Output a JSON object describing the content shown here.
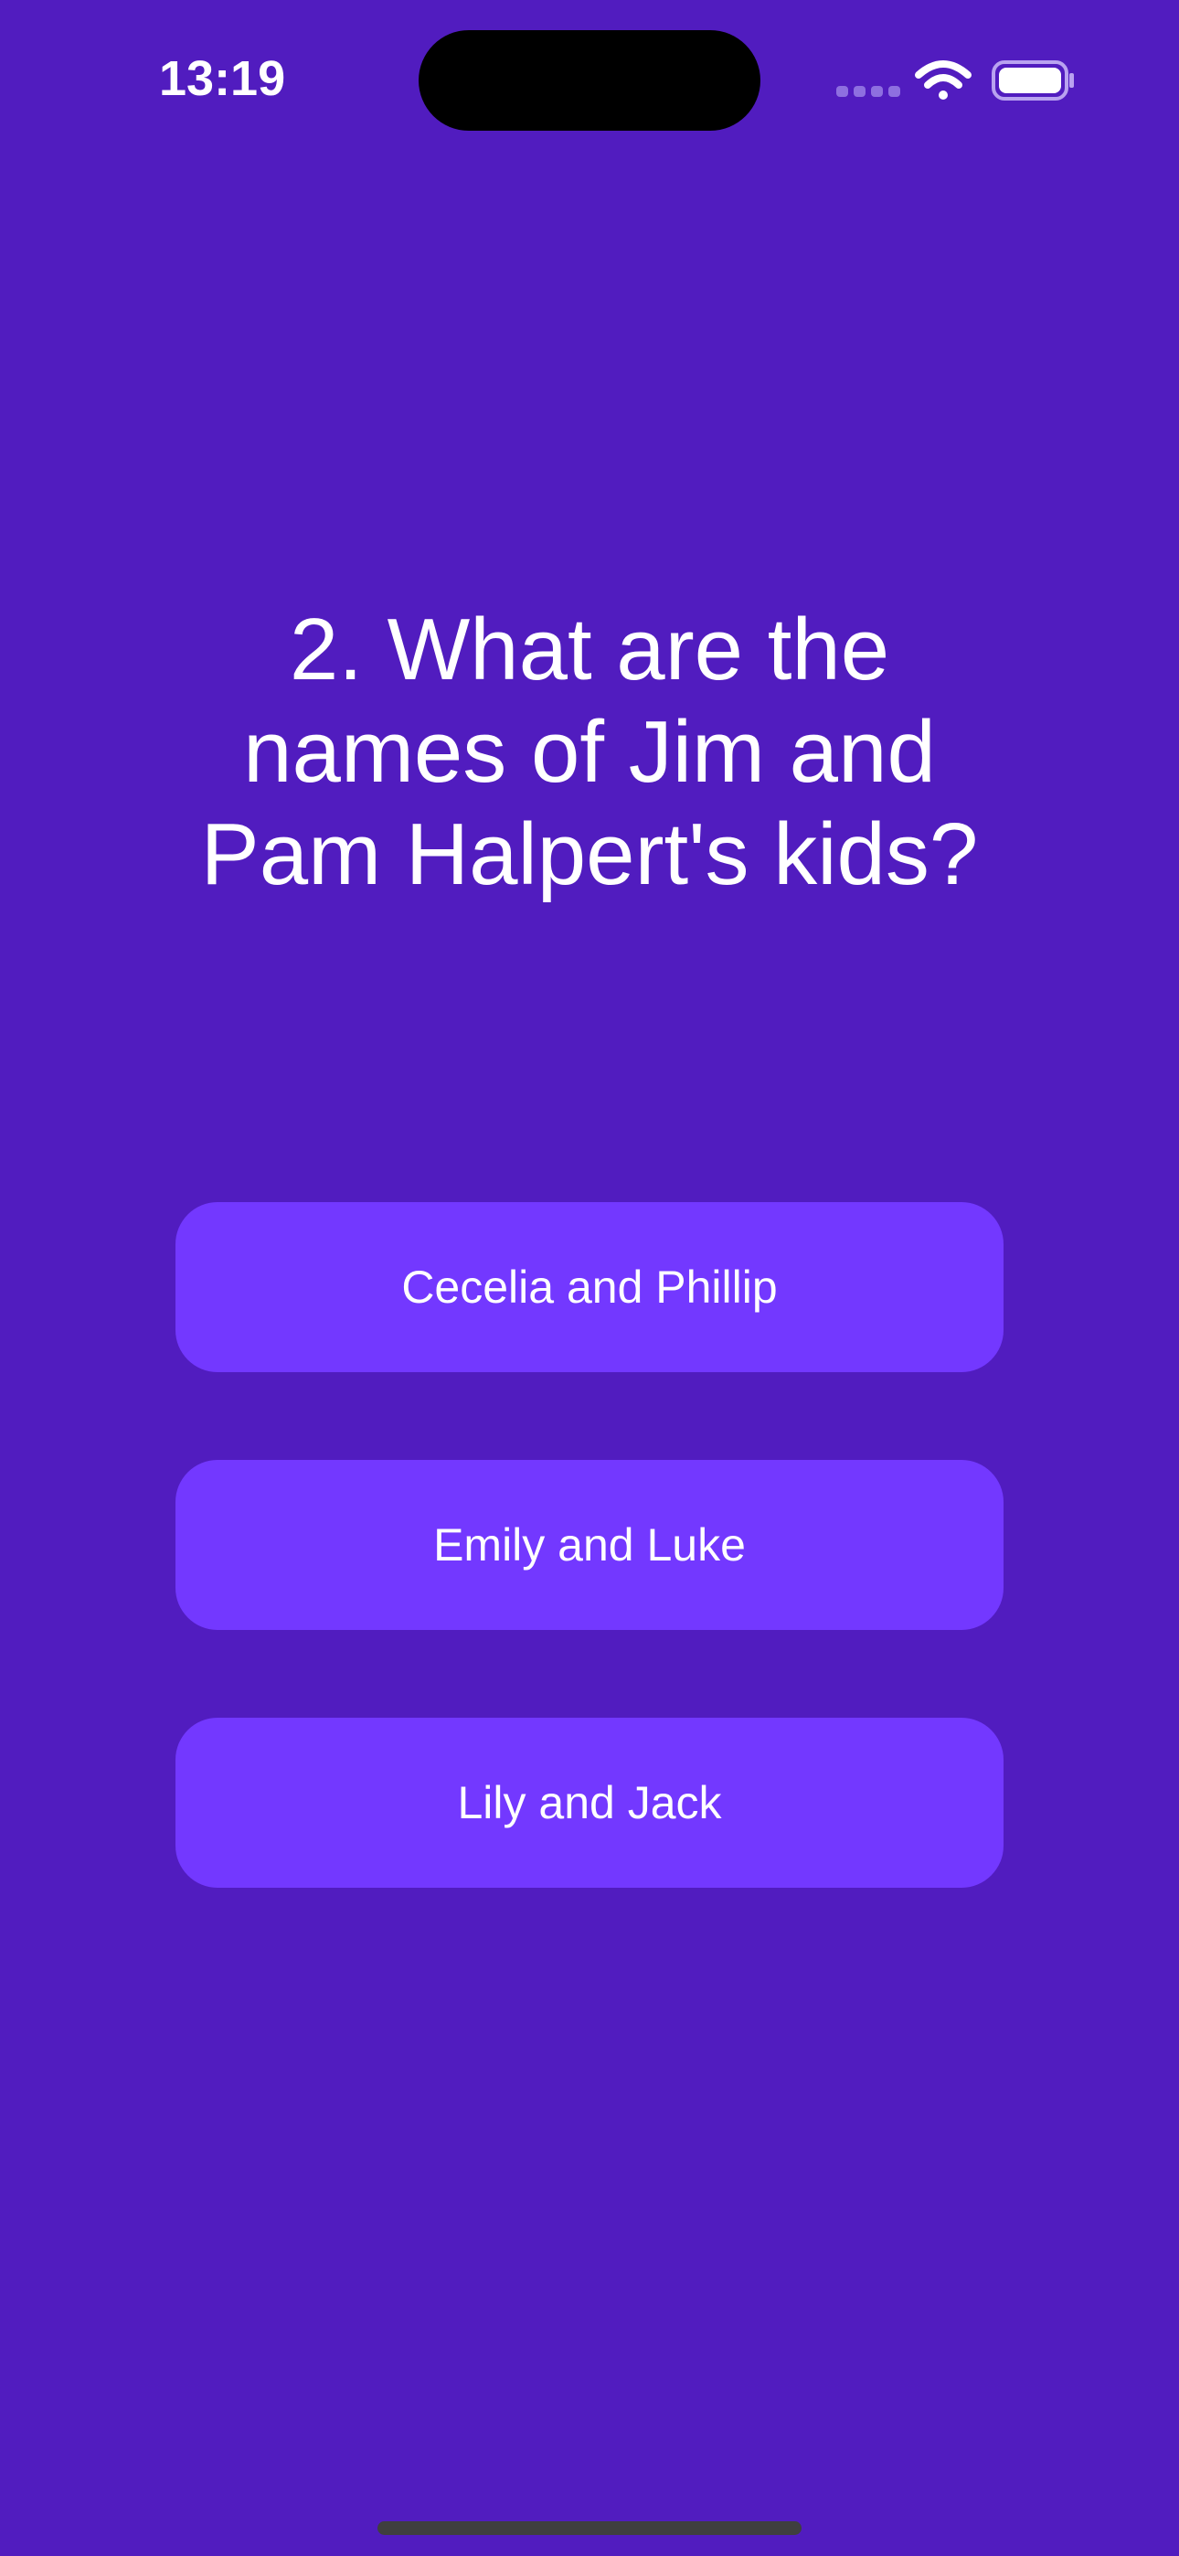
{
  "status_bar": {
    "time": "13:19",
    "icons": [
      "signal-icon",
      "wifi-icon",
      "battery-icon"
    ]
  },
  "quiz": {
    "question": "2. What are the names of Jim and Pam Halpert's kids?",
    "answers": [
      {
        "label": "Cecelia and Phillip"
      },
      {
        "label": "Emily and Luke"
      },
      {
        "label": "Lily and Jack"
      }
    ]
  },
  "colors": {
    "background": "#511CBF",
    "button": "#7338FF",
    "text": "#FFFFFF"
  }
}
